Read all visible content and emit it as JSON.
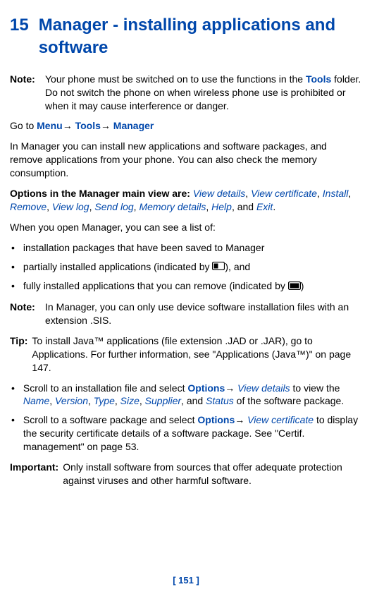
{
  "chapter": {
    "number": "15",
    "title": "Manager - installing applications and software"
  },
  "note1": {
    "label": "Note:",
    "pre": "Your phone must be switched on to use the functions in the ",
    "tools": "Tools",
    "post": " folder. Do not switch the phone on when wireless phone use is prohibited or when it may cause interference or danger."
  },
  "goto": {
    "prefix": "Go to ",
    "menu": "Menu",
    "tools": "Tools",
    "manager": "Manager",
    "arrow": "→"
  },
  "intro": "In Manager you can install new applications and software packages, and remove applications from your phone. You can also check the memory consumption.",
  "options": {
    "prefix": "Options in the Manager main view are: ",
    "items": [
      "View details",
      "View certificate",
      "Install",
      "Remove",
      "View log",
      "Send log",
      "Memory details",
      "Help",
      "Exit"
    ],
    "and": "and",
    "sep": ", "
  },
  "listintro": "When you open Manager, you can see a list of:",
  "bullets1": {
    "b1": "installation packages that have been saved to Manager",
    "b2_pre": "partially installed applications (indicated by ",
    "b2_post": "), and",
    "b3_pre": "fully installed applications that you can remove (indicated by ",
    "b3_post": ")"
  },
  "note2": {
    "label": "Note:",
    "text": "In Manager, you can only use device software installation files with an extension .SIS."
  },
  "tip": {
    "label": "Tip:",
    "text": "To install Java™ applications (file extension .JAD or .JAR), go to Applications. For further information, see \"Applications (Java™)\" on page 147."
  },
  "bullets2": {
    "b1_pre": "Scroll to an installation file and select ",
    "b1_options": "Options",
    "b1_arrow": "→ ",
    "b1_viewdetails": "View details",
    "b1_mid": " to view the ",
    "b1_fields": [
      "Name",
      "Version",
      "Type",
      "Size",
      "Supplier",
      "Status"
    ],
    "b1_and": "and",
    "b1_post": " of the software package.",
    "b2_pre": "Scroll to a software package and select ",
    "b2_options": "Options",
    "b2_arrow": "→ ",
    "b2_viewcert": "View certificate",
    "b2_post": " to display the security certificate details of a software package. See \"Certif. management\" on page 53."
  },
  "important": {
    "label": "Important:",
    "text": "Only install software from sources that offer adequate protection against viruses and other harmful software."
  },
  "footer": "[ 151 ]",
  "bullet_marker": "•"
}
